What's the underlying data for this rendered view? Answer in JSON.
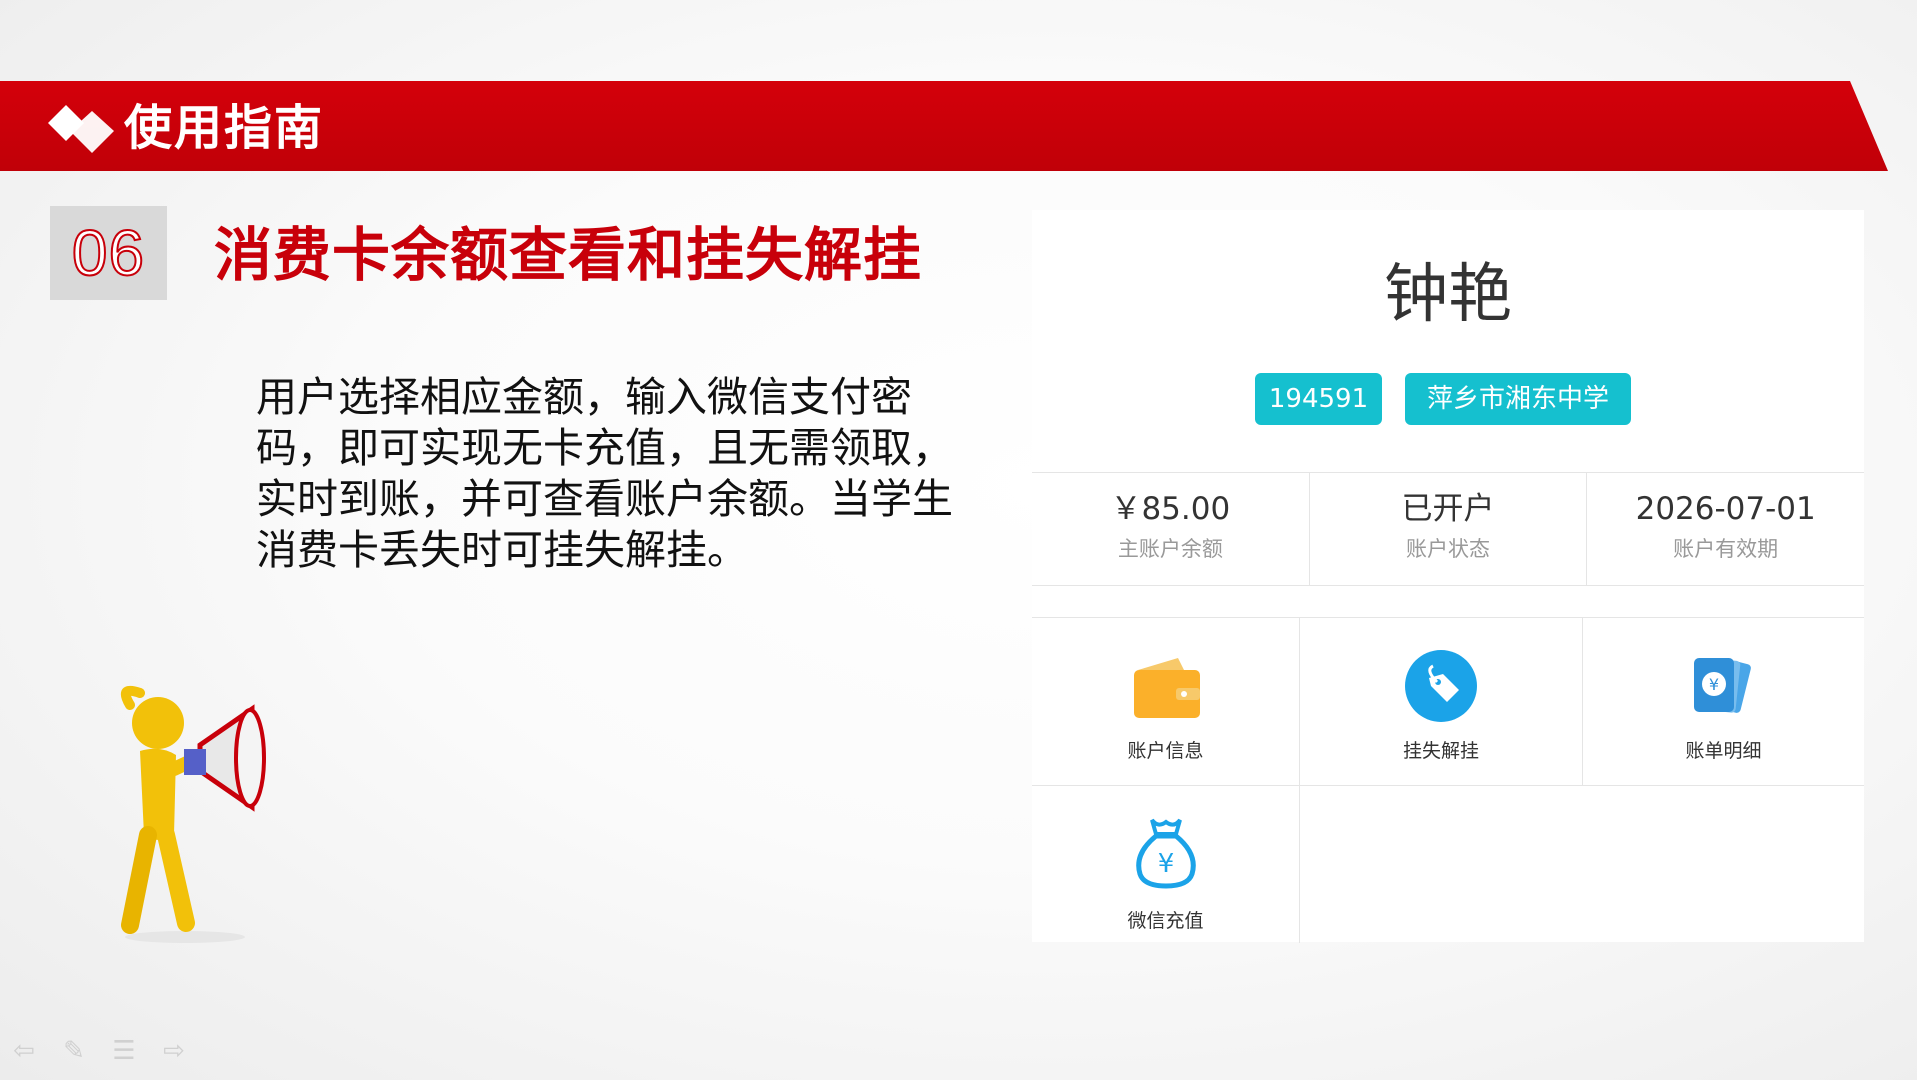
{
  "header": {
    "title": "使用指南"
  },
  "section": {
    "number": "06",
    "title": "消费卡余额查看和挂失解挂",
    "description": "用户选择相应金额，输入微信支付密码，即可实现无卡充值，且无需领取，实时到账，并可查看账户余额。当学生消费卡丢失时可挂失解挂。"
  },
  "account": {
    "name": "钟艳",
    "id_tag": "194591",
    "school_tag": "萍乡市湘东中学",
    "stats": [
      {
        "value": "￥85.00",
        "label": "主账户余额"
      },
      {
        "value": "已开户",
        "label": "账户状态"
      },
      {
        "value": "2026-07-01",
        "label": "账户有效期"
      }
    ],
    "menu": [
      {
        "label": "账户信息",
        "icon": "wallet-icon"
      },
      {
        "label": "挂失解挂",
        "icon": "tag-icon"
      },
      {
        "label": "账单明细",
        "icon": "bill-icon"
      },
      {
        "label": "微信充值",
        "icon": "money-bag-icon"
      }
    ]
  },
  "colors": {
    "brand_red": "#c8000a",
    "tag_teal": "#15c0cf",
    "wallet_orange": "#fbb02a",
    "icon_blue": "#1ba3e8"
  },
  "nav": {
    "icons": [
      "prev-icon",
      "pen-icon",
      "menu-icon",
      "next-icon"
    ]
  }
}
